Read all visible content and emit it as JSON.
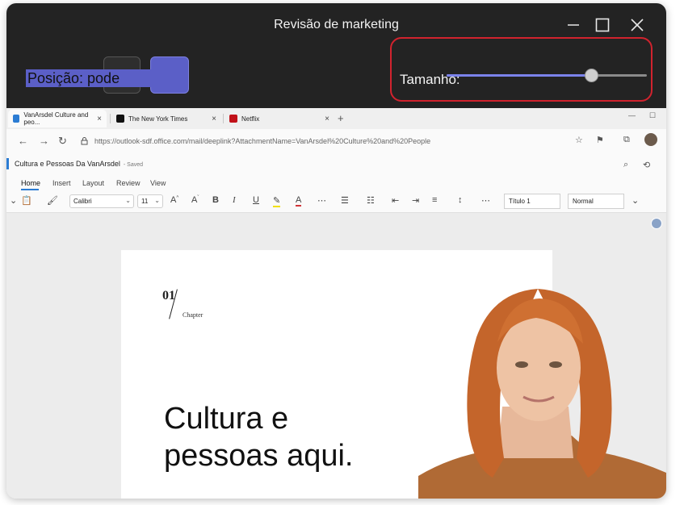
{
  "window": {
    "title": "Revisão de marketing",
    "minimize_glyph": "—",
    "maximize_glyph": "☐",
    "close_glyph": "✕"
  },
  "position": {
    "label": "Posição: pode"
  },
  "size": {
    "label": "Tamanho:",
    "slider_value_percent": 72
  },
  "browser": {
    "tabs": [
      {
        "label": "VanArsdel Culture and peo...",
        "active": true
      },
      {
        "label": "The New York Times",
        "active": false
      },
      {
        "label": "Netflix",
        "active": false
      }
    ],
    "new_tab_glyph": "+",
    "url": "https://outlook-sdf.office.com/mail/deeplink?AttachmentName=VanArsdel%20Culture%20and%20People"
  },
  "app": {
    "doc_title": "Cultura e Pessoas Da VanArsdel",
    "saved_status": "- Saved",
    "ribbon_tabs": [
      "Home",
      "Insert",
      "Layout",
      "Review",
      "View"
    ],
    "font_name": "Calibri",
    "font_size": "11",
    "style_heading": "Título 1",
    "style_normal": "Normal"
  },
  "document": {
    "chapter_number": "01",
    "chapter_label": "Chapter",
    "headline_line1": "Cultura e",
    "headline_line2": "pessoas aqui."
  },
  "colors": {
    "accent": "#5b5fc7",
    "highlight_border": "#d1232e",
    "title_bar": "#232323"
  }
}
